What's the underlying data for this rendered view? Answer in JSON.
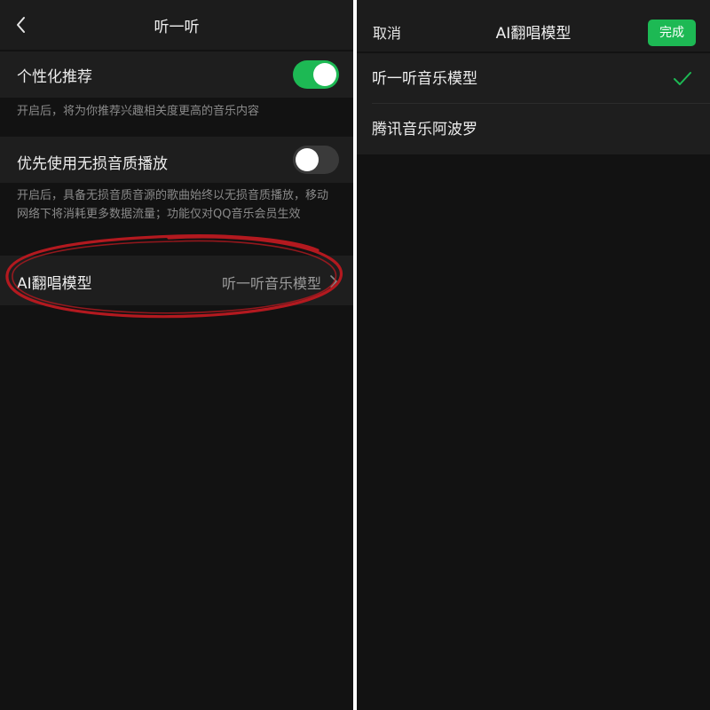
{
  "left_screen": {
    "nav": {
      "title": "听一听",
      "back_icon": "chevron-left-icon"
    },
    "personalized": {
      "label": "个性化推荐",
      "enabled": true,
      "description": "开启后，将为你推荐兴趣相关度更高的音乐内容"
    },
    "lossless": {
      "label": "优先使用无损音质播放",
      "enabled": false,
      "description": "开启后，具备无损音质音源的歌曲始终以无损音质播放，移动网络下将消耗更多数据流量；功能仅对QQ音乐会员生效"
    },
    "ai_model_row": {
      "label": "AI翻唱模型",
      "value": "听一听音乐模型",
      "chevron_icon": "chevron-right-icon"
    },
    "annotation": {
      "shape": "hand-drawn ellipse",
      "color": "#b3191f"
    }
  },
  "right_screen": {
    "nav": {
      "cancel_label": "取消",
      "title": "AI翻唱模型",
      "done_label": "完成"
    },
    "options": [
      {
        "label": "听一听音乐模型",
        "selected": true
      },
      {
        "label": "腾讯音乐阿波罗",
        "selected": false
      }
    ],
    "check_icon": "checkmark-icon"
  },
  "colors": {
    "accent_green": "#1db954",
    "background": "#121212",
    "row_background": "#1e1e1e",
    "nav_background": "#1c1c1c",
    "secondary_text": "#8a8a8a",
    "annotation_red": "#b3191f"
  }
}
